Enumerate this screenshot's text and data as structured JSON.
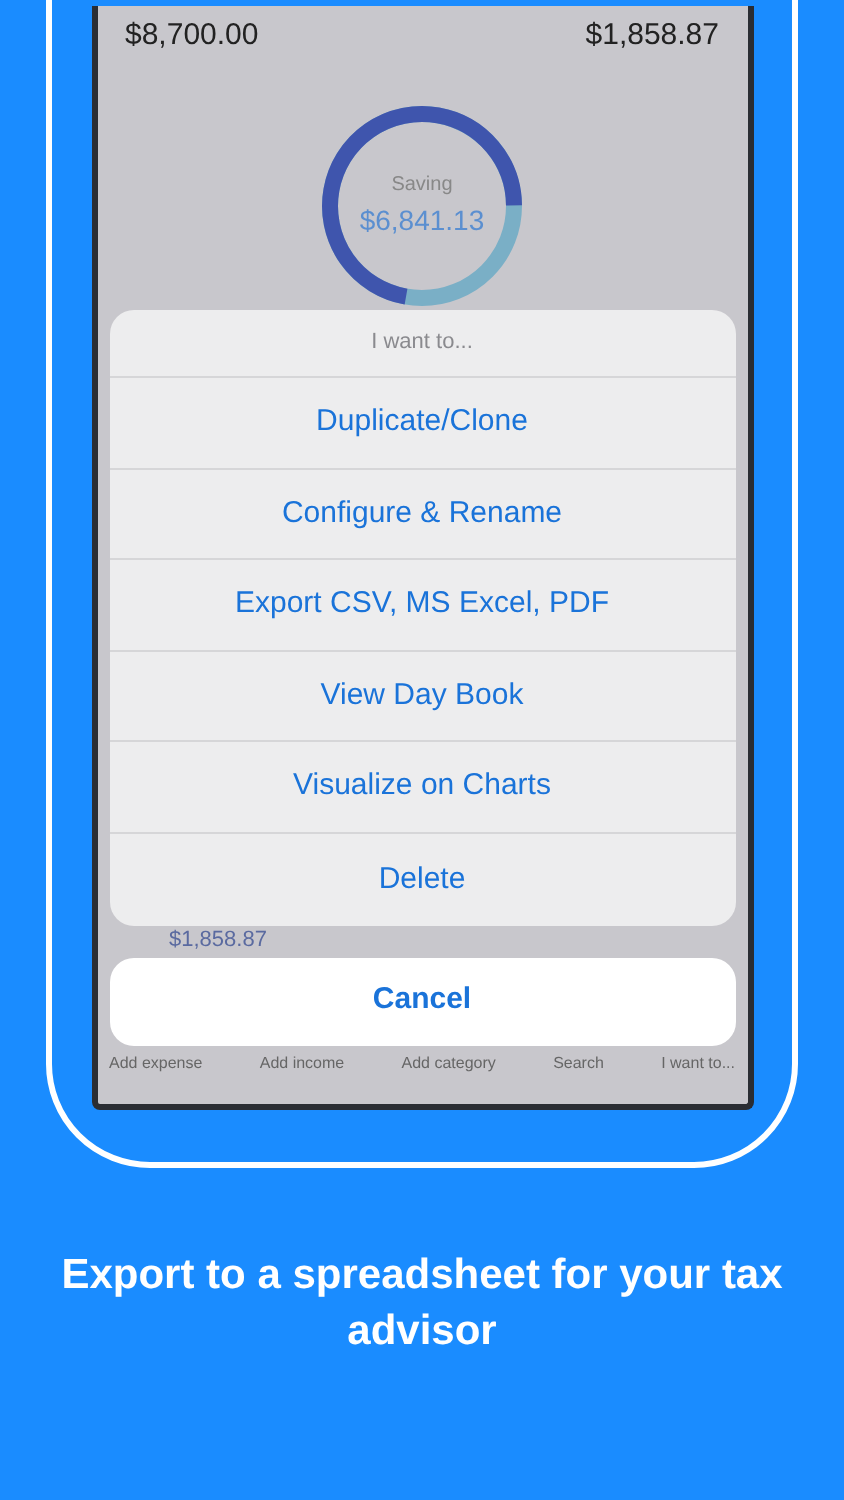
{
  "summary": {
    "left_amount": "$8,700.00",
    "right_amount": "$1,858.87",
    "saving_label": "Saving",
    "saving_amount": "$6,841.13"
  },
  "row_peek": {
    "amount": "$1,858.87"
  },
  "action_sheet": {
    "title": "I want to...",
    "actions": [
      {
        "label": "Duplicate/Clone"
      },
      {
        "label": "Configure & Rename"
      },
      {
        "label": "Export CSV, MS Excel, PDF"
      },
      {
        "label": "View Day Book"
      },
      {
        "label": "Visualize on Charts"
      },
      {
        "label": "Delete"
      }
    ],
    "cancel": "Cancel"
  },
  "tab_bar": [
    {
      "label": "Add expense"
    },
    {
      "label": "Add income"
    },
    {
      "label": "Add category"
    },
    {
      "label": "Search"
    },
    {
      "label": "I want to..."
    }
  ],
  "caption": "Export to a spreadsheet for your tax advisor"
}
